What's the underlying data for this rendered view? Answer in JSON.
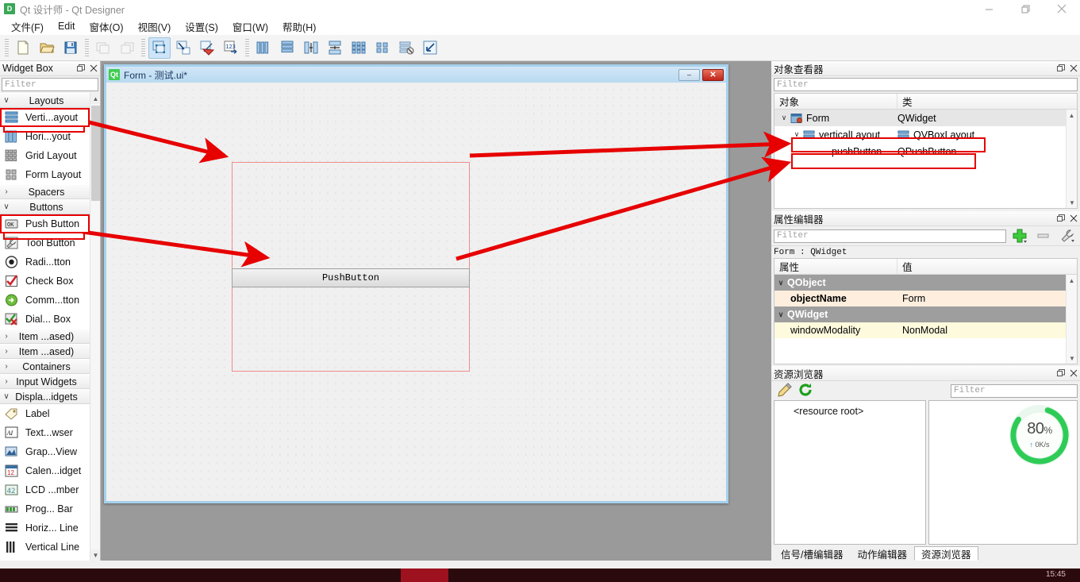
{
  "window": {
    "app_icon": "D",
    "title": "Qt 设计师 - Qt Designer",
    "minimize": "minimize-icon",
    "maximize": "restore-icon",
    "close": "close-icon"
  },
  "menubar": {
    "items": [
      {
        "label": "文件(F)",
        "name": "menu-file"
      },
      {
        "label": "Edit",
        "name": "menu-edit"
      },
      {
        "label": "窗体(O)",
        "name": "menu-form"
      },
      {
        "label": "视图(V)",
        "name": "menu-view"
      },
      {
        "label": "设置(S)",
        "name": "menu-settings"
      },
      {
        "label": "窗口(W)",
        "name": "menu-window"
      },
      {
        "label": "帮助(H)",
        "name": "menu-help"
      }
    ]
  },
  "toolbar": {
    "groups": [
      [
        "new-form",
        "open-form",
        "save-form"
      ],
      [
        "undo",
        "redo"
      ],
      [
        "edit-widgets",
        "edit-signals-slots",
        "edit-buddies",
        "edit-tab-order"
      ],
      [
        "layout-horizontally",
        "layout-vertically",
        "layout-splitter-h",
        "layout-splitter-v",
        "layout-grid",
        "layout-form",
        "break-layout",
        "adjust-size"
      ]
    ]
  },
  "widget_box": {
    "title": "Widget Box",
    "float_icon": "float-icon",
    "close_icon": "close-icon",
    "filter_placeholder": "Filter",
    "rows": [
      {
        "type": "group",
        "label": "Layouts",
        "expanded": true,
        "name": "group-layouts"
      },
      {
        "type": "item",
        "label": "Verti...ayout",
        "icon": "vertical-layout-icon",
        "highlighted": true,
        "name": "widget-vertical-layout"
      },
      {
        "type": "item",
        "label": "Hori...yout",
        "icon": "horizontal-layout-icon",
        "name": "widget-horizontal-layout"
      },
      {
        "type": "item",
        "label": "Grid Layout",
        "icon": "grid-layout-icon",
        "name": "widget-grid-layout"
      },
      {
        "type": "item",
        "label": "Form Layout",
        "icon": "form-layout-icon",
        "name": "widget-form-layout"
      },
      {
        "type": "group",
        "label": "Spacers",
        "expanded": false,
        "name": "group-spacers"
      },
      {
        "type": "group",
        "label": "Buttons",
        "expanded": true,
        "name": "group-buttons"
      },
      {
        "type": "item",
        "label": "Push Button",
        "icon": "push-button-icon",
        "highlighted": true,
        "name": "widget-push-button"
      },
      {
        "type": "item",
        "label": "Tool Button",
        "icon": "tool-button-icon",
        "name": "widget-tool-button"
      },
      {
        "type": "item",
        "label": "Radi...tton",
        "icon": "radio-button-icon",
        "name": "widget-radio-button"
      },
      {
        "type": "item",
        "label": "Check Box",
        "icon": "check-box-icon",
        "name": "widget-check-box"
      },
      {
        "type": "item",
        "label": "Comm...tton",
        "icon": "command-link-button-icon",
        "name": "widget-command-link-button"
      },
      {
        "type": "item",
        "label": "Dial... Box",
        "icon": "dialog-button-box-icon",
        "name": "widget-dialog-button-box"
      },
      {
        "type": "group",
        "label": "Item ...ased)",
        "expanded": false,
        "name": "group-item-views"
      },
      {
        "type": "group",
        "label": "Item ...ased)",
        "expanded": false,
        "name": "group-item-widgets"
      },
      {
        "type": "group",
        "label": "Containers",
        "expanded": false,
        "name": "group-containers"
      },
      {
        "type": "group",
        "label": "Input Widgets",
        "expanded": false,
        "name": "group-input-widgets"
      },
      {
        "type": "group",
        "label": "Displa...idgets",
        "expanded": true,
        "name": "group-display-widgets"
      },
      {
        "type": "item",
        "label": "Label",
        "icon": "label-icon",
        "name": "widget-label"
      },
      {
        "type": "item",
        "label": "Text...wser",
        "icon": "text-browser-icon",
        "name": "widget-text-browser"
      },
      {
        "type": "item",
        "label": "Grap...View",
        "icon": "graphics-view-icon",
        "name": "widget-graphics-view"
      },
      {
        "type": "item",
        "label": "Calen...idget",
        "icon": "calendar-widget-icon",
        "name": "widget-calendar-widget"
      },
      {
        "type": "item",
        "label": "LCD ...mber",
        "icon": "lcd-number-icon",
        "name": "widget-lcd-number"
      },
      {
        "type": "item",
        "label": "Prog... Bar",
        "icon": "progress-bar-icon",
        "name": "widget-progress-bar"
      },
      {
        "type": "item",
        "label": "Horiz... Line",
        "icon": "horizontal-line-icon",
        "name": "widget-horizontal-line"
      },
      {
        "type": "item",
        "label": "Vertical Line",
        "icon": "vertical-line-icon",
        "name": "widget-vertical-line"
      }
    ]
  },
  "form_window": {
    "icon": "Qt",
    "title": "Form - 测试.ui*",
    "minimize_label": "–",
    "close_label": "✕",
    "pushbutton_label": "PushButton"
  },
  "object_inspector": {
    "title": "对象查看器",
    "filter_placeholder": "Filter",
    "columns": [
      "对象",
      "类"
    ],
    "rows": [
      {
        "object": "Form",
        "class": "QWidget",
        "depth": 0,
        "expandable": true,
        "icon": "form-icon",
        "selected": true,
        "name": "tree-row-form"
      },
      {
        "object": "verticalLayout",
        "class": "QVBoxLayout",
        "depth": 1,
        "expandable": true,
        "icon": "vlayout-icon",
        "highlighted": true,
        "name": "tree-row-vertical-layout"
      },
      {
        "object": "pushButton",
        "class": "QPushButton",
        "depth": 2,
        "expandable": false,
        "icon": "",
        "highlighted": true,
        "name": "tree-row-push-button"
      }
    ]
  },
  "property_editor": {
    "title": "属性编辑器",
    "filter_placeholder": "Filter",
    "add_icon": "add-icon",
    "remove_icon": "remove-icon",
    "configure_icon": "wrench-icon",
    "context": "Form : QWidget",
    "columns": [
      "属性",
      "值"
    ],
    "rows": [
      {
        "kind": "group",
        "property": "QObject",
        "value": "",
        "name": "property-group-qobject"
      },
      {
        "kind": "prop",
        "property": "objectName",
        "value": "Form",
        "tone": "orange",
        "name": "property-objectname"
      },
      {
        "kind": "group",
        "property": "QWidget",
        "value": "",
        "name": "property-group-qwidget"
      },
      {
        "kind": "prop",
        "property": "windowModality",
        "value": "NonModal",
        "tone": "yellow",
        "name": "property-windowmodality"
      }
    ]
  },
  "resource_browser": {
    "title": "资源浏览器",
    "edit_icon": "pencil-icon",
    "reload_icon": "reload-icon",
    "filter_placeholder": "Filter",
    "root_label": "<resource root>",
    "gauge": {
      "percent": "80",
      "percent_unit": "%",
      "speed": "0K/s",
      "arrow": "up-arrow-icon",
      "color": "#2ecc57"
    },
    "tabs": [
      {
        "label": "信号/槽编辑器",
        "active": false,
        "name": "tab-signal-slot-editor"
      },
      {
        "label": "动作编辑器",
        "active": false,
        "name": "tab-action-editor"
      },
      {
        "label": "资源浏览器",
        "active": true,
        "name": "tab-resource-browser"
      }
    ]
  },
  "taskbar": {
    "clock": "15:45"
  },
  "colors": {
    "annotation": "#e60000",
    "accent": "#2ecc57",
    "titlebar": "#ffffff",
    "mdi_background": "#9a9a9a"
  }
}
